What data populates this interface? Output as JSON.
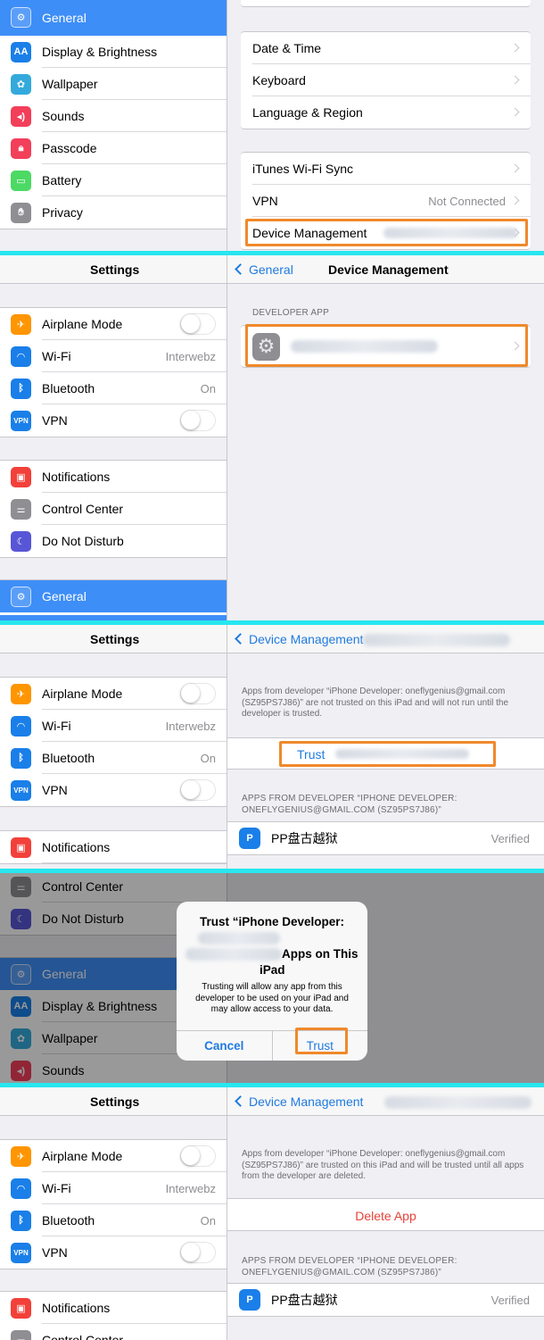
{
  "colors": {
    "accent": "#1f7ae0",
    "selection": "#3e8ef7",
    "highlight": "#f0892b",
    "divider": "#27e6ef",
    "destructive": "#e8423a"
  },
  "icons": {
    "general": "gear-icon",
    "display": "text-size-icon",
    "wallpaper": "flower-icon",
    "sounds": "speaker-icon",
    "passcode": "lock-icon",
    "battery": "battery-icon",
    "privacy": "hand-icon",
    "airplane": "airplane-icon",
    "wifi": "wifi-icon",
    "bluetooth": "bluetooth-icon",
    "vpn": "vpn-icon",
    "notifications": "notifications-icon",
    "control_center": "toggles-icon",
    "dnd": "moon-icon"
  },
  "common": {
    "settings_title": "Settings",
    "airplane": "Airplane Mode",
    "wifi": "Wi-Fi",
    "wifi_value": "Interwebz",
    "bluetooth": "Bluetooth",
    "bluetooth_value": "On",
    "vpn": "VPN",
    "vpn_badge": "VPN",
    "notifications": "Notifications",
    "control_center": "Control Center",
    "dnd": "Do Not Disturb",
    "general": "General",
    "display": "Display & Brightness",
    "display_badge": "AA",
    "wallpaper": "Wallpaper",
    "sounds": "Sounds",
    "passcode": "Passcode",
    "battery": "Battery",
    "privacy": "Privacy",
    "device_management": "Device Management",
    "verified": "Verified",
    "pp_app": "PP盘古越狱"
  },
  "panel1": {
    "rows": [
      {
        "label": "Date & Time"
      },
      {
        "label": "Keyboard"
      },
      {
        "label": "Language & Region"
      }
    ],
    "rows2": [
      {
        "label": "iTunes Wi-Fi Sync",
        "value": ""
      },
      {
        "label": "VPN",
        "value": "Not Connected"
      },
      {
        "label": "Device Management",
        "value": ""
      }
    ]
  },
  "panel2": {
    "back": "General",
    "title": "Device Management",
    "section": "DEVELOPER APP"
  },
  "panel3": {
    "back": "Device Management",
    "note": "Apps from developer “iPhone Developer: oneflygenius@gmail.com (SZ95PS7J86)” are not trusted on this iPad and will not run until the developer is trusted.",
    "trust": "Trust",
    "section": "APPS FROM DEVELOPER “IPHONE DEVELOPER: ONEFLYGENIUS@GMAIL.COM (SZ95PS7J86)”"
  },
  "panel4": {
    "alert_title_1": "Trust “iPhone Developer:",
    "alert_title_2": "Apps on This",
    "alert_title_3": "iPad",
    "alert_msg": "Trusting will allow any app from this developer to be used on your iPad and may allow access to your data.",
    "cancel": "Cancel",
    "trust": "Trust"
  },
  "panel5": {
    "back": "Device Management",
    "note": "Apps from developer “iPhone Developer: oneflygenius@gmail.com (SZ95PS7J86)” are trusted on this iPad and will be trusted until all apps from the developer are deleted.",
    "delete": "Delete App",
    "section": "APPS FROM DEVELOPER “IPHONE DEVELOPER: ONEFLYGENIUS@GMAIL.COM (SZ95PS7J86)”"
  }
}
